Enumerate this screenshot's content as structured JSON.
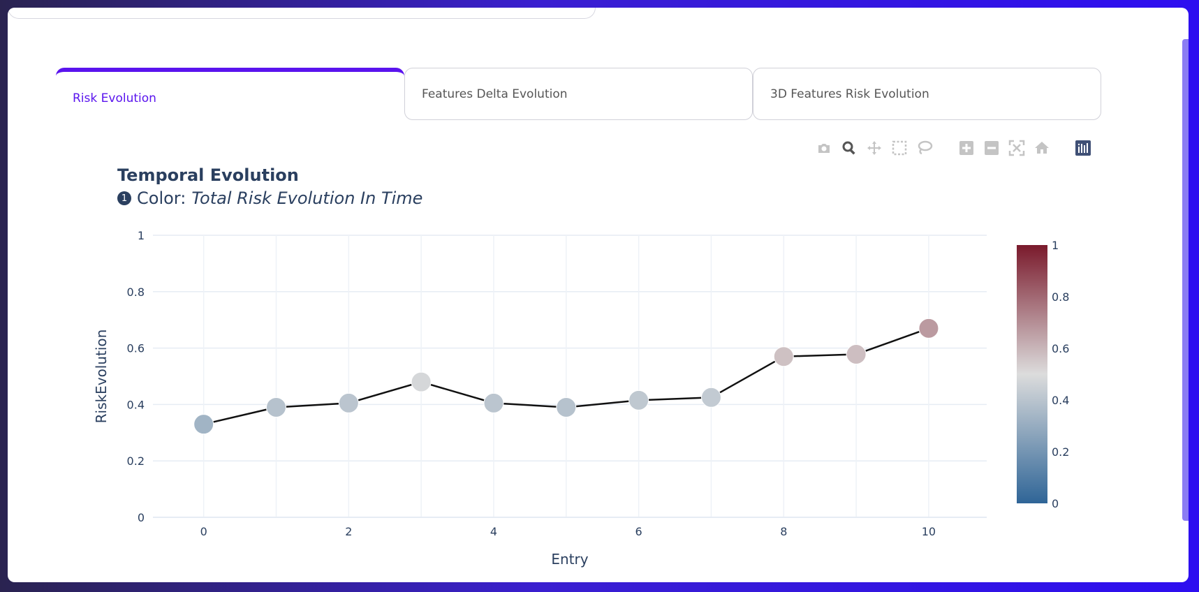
{
  "tabs": [
    {
      "label": "Risk Evolution",
      "active": true
    },
    {
      "label": "Features Delta Evolution",
      "active": false
    },
    {
      "label": "3D Features Risk Evolution",
      "active": false
    }
  ],
  "toolbar": [
    "camera-icon",
    "zoom-icon",
    "pan-icon",
    "box-select-icon",
    "lasso-select-icon",
    "zoom-in-icon",
    "zoom-out-icon",
    "autoscale-icon",
    "reset-axes-icon",
    "plotly-logo-icon"
  ],
  "header": {
    "title": "Temporal Evolution",
    "subtitle_badge": "1",
    "subtitle_label": "Color:",
    "subtitle_value": "Total Risk Evolution In Time"
  },
  "colors": {
    "accent": "#5a14ee",
    "text": "#2a3f5f",
    "line": "#111111",
    "grid": "#e6ecf4"
  },
  "chart_data": {
    "type": "scatter",
    "mode": "lines+markers",
    "x": [
      0,
      1,
      2,
      3,
      4,
      5,
      6,
      7,
      8,
      9,
      10
    ],
    "y": [
      0.33,
      0.39,
      0.405,
      0.48,
      0.405,
      0.39,
      0.415,
      0.425,
      0.57,
      0.578,
      0.67
    ],
    "xlabel": "Entry",
    "ylabel": "RiskEvolution",
    "xlim": [
      -0.7,
      10.8
    ],
    "ylim": [
      0,
      1
    ],
    "xticks": [
      0,
      2,
      4,
      6,
      8,
      10
    ],
    "yticks": [
      0,
      0.2,
      0.4,
      0.6,
      0.8,
      1
    ],
    "colorscale": {
      "min": 0,
      "max": 1,
      "ticks": [
        0,
        0.2,
        0.4,
        0.6,
        0.8,
        1
      ],
      "stops": [
        "#2f6597",
        "#dcdcdc",
        "#7a1a2c"
      ]
    },
    "grid": true
  }
}
